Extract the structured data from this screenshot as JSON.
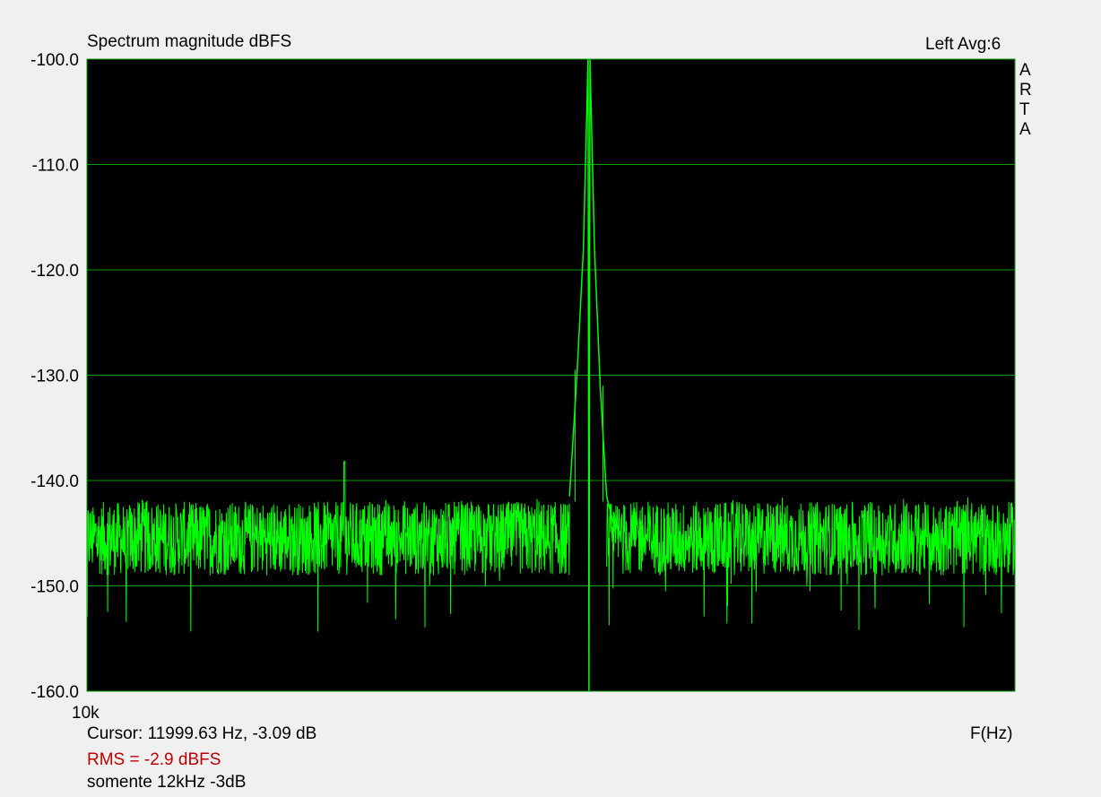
{
  "header": {
    "title": "Spectrum magnitude dBFS",
    "channel_info": "Left  Avg:6",
    "brand_letters": [
      "A",
      "R",
      "T",
      "A"
    ]
  },
  "footer": {
    "x_start_label": "10k",
    "cursor_readout": "Cursor: 11999.63 Hz, -3.09 dB",
    "x_axis_label": "F(Hz)",
    "rms_readout": "RMS =   -2.9 dBFS",
    "note": "somente 12kHz -3dB"
  },
  "colors": {
    "plot_background": "#000000",
    "grid": "#00a000",
    "trace": "#00ff00",
    "rms_text": "#c00000"
  },
  "chart_data": {
    "type": "line",
    "title": "Spectrum magnitude dBFS",
    "xlabel": "F(Hz)",
    "ylabel": "",
    "ylim": [
      -160,
      -100
    ],
    "yticks": [
      "-100.0",
      "-110.0",
      "-120.0",
      "-130.0",
      "-140.0",
      "-150.0",
      "-160.0"
    ],
    "xticks": [
      "10k"
    ],
    "grid": true,
    "series": [
      {
        "noise_floor_db": -145.5,
        "noise_spread_db": 3.5,
        "noise_min_db": -155,
        "noise_max_db": -141,
        "peak_db": -100,
        "spur_db": -138,
        "points_db": [
          [
            0.0,
            -145.5
          ],
          [
            0.1,
            -145.0
          ],
          [
            0.2,
            -146.0
          ],
          [
            0.2775,
            -138.2
          ],
          [
            0.3,
            -145.5
          ],
          [
            0.4,
            -145.5
          ],
          [
            0.5,
            -145.0
          ],
          [
            0.52,
            -141.5
          ],
          [
            0.528,
            -130.0
          ],
          [
            0.535,
            -118.0
          ],
          [
            0.54,
            -100.0
          ],
          [
            0.541,
            -160.0
          ],
          [
            0.542,
            -100.0
          ],
          [
            0.547,
            -118.0
          ],
          [
            0.553,
            -131.0
          ],
          [
            0.56,
            -141.5
          ],
          [
            0.57,
            -145.0
          ],
          [
            0.7,
            -145.5
          ],
          [
            0.8,
            -145.5
          ],
          [
            0.9,
            -145.0
          ],
          [
            1.0,
            -145.5
          ]
        ]
      }
    ],
    "annotations": [
      "Cursor: 11999.63 Hz, -3.09 dB",
      "RMS =   -2.9 dBFS",
      "somente 12kHz -3dB"
    ]
  }
}
